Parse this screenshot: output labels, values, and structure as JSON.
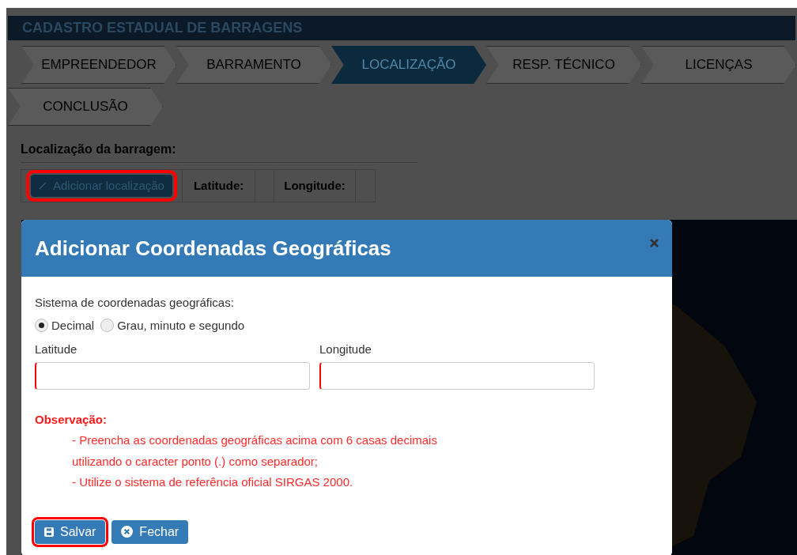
{
  "header": {
    "title": "CADASTRO ESTADUAL DE BARRAGENS"
  },
  "steps": [
    {
      "label": "EMPREENDEDOR",
      "selected": false
    },
    {
      "label": "BARRAMENTO",
      "selected": false
    },
    {
      "label": "LOCALIZAÇÃO",
      "selected": true
    },
    {
      "label": "RESP. TÉCNICO",
      "selected": false
    },
    {
      "label": "LICENÇAS",
      "selected": false
    },
    {
      "label": "CONCLUSÃO",
      "selected": false
    }
  ],
  "location": {
    "label": "Localização da barragem:",
    "add_button": "Adicionar localização",
    "add_button_highlighted": true,
    "latitude_label": "Latitude:",
    "longitude_label": "Longitude:"
  },
  "dialog": {
    "title": "Adicionar Coordenadas Geográficas",
    "system_label": "Sistema de coordenadas geográficas:",
    "systems": [
      {
        "label": "Decimal",
        "selected": true
      },
      {
        "label": "Grau, minuto e segundo",
        "selected": false
      }
    ],
    "fields": [
      {
        "label": "Latitude",
        "invalid": true
      },
      {
        "label": "Longitude",
        "invalid": true
      }
    ],
    "note_title": "Observação:",
    "note_lines": [
      "- Preencha as coordenadas geográficas acima com 6 casas decimais",
      "utilizando o caracter ponto (.) como separador;",
      "- Utilize o sistema de referência oficial SIRGAS 2000."
    ],
    "buttons": [
      {
        "kind": "save",
        "label": "Salvar",
        "highlighted": true
      },
      {
        "kind": "close",
        "label": "Fechar",
        "highlighted": false
      }
    ]
  }
}
